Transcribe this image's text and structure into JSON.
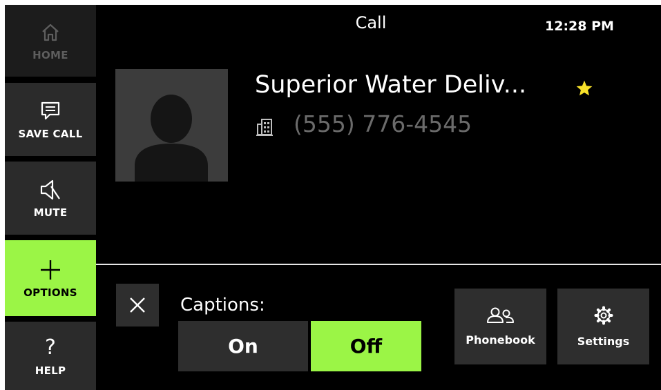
{
  "nav": {
    "home_label": "HOME",
    "save_call_label": "SAVE CALL",
    "mute_label": "MUTE",
    "options_label": "OPTIONS",
    "help_label": "HELP",
    "help_glyph": "?"
  },
  "header": {
    "title": "Call",
    "time": "12:28 PM"
  },
  "contact": {
    "name": "Superior Water Deliv...",
    "number": "(555) 776-4545",
    "favorite": true,
    "phone_type_icon": "building-icon"
  },
  "options_panel": {
    "captions_label": "Captions:",
    "on_label": "On",
    "off_label": "Off",
    "selected": "Off",
    "phonebook_label": "Phonebook",
    "settings_label": "Settings"
  },
  "colors": {
    "accent": "#9bf546",
    "background": "#000000",
    "button": "#2e2e2e",
    "star": "#f7e12a"
  }
}
